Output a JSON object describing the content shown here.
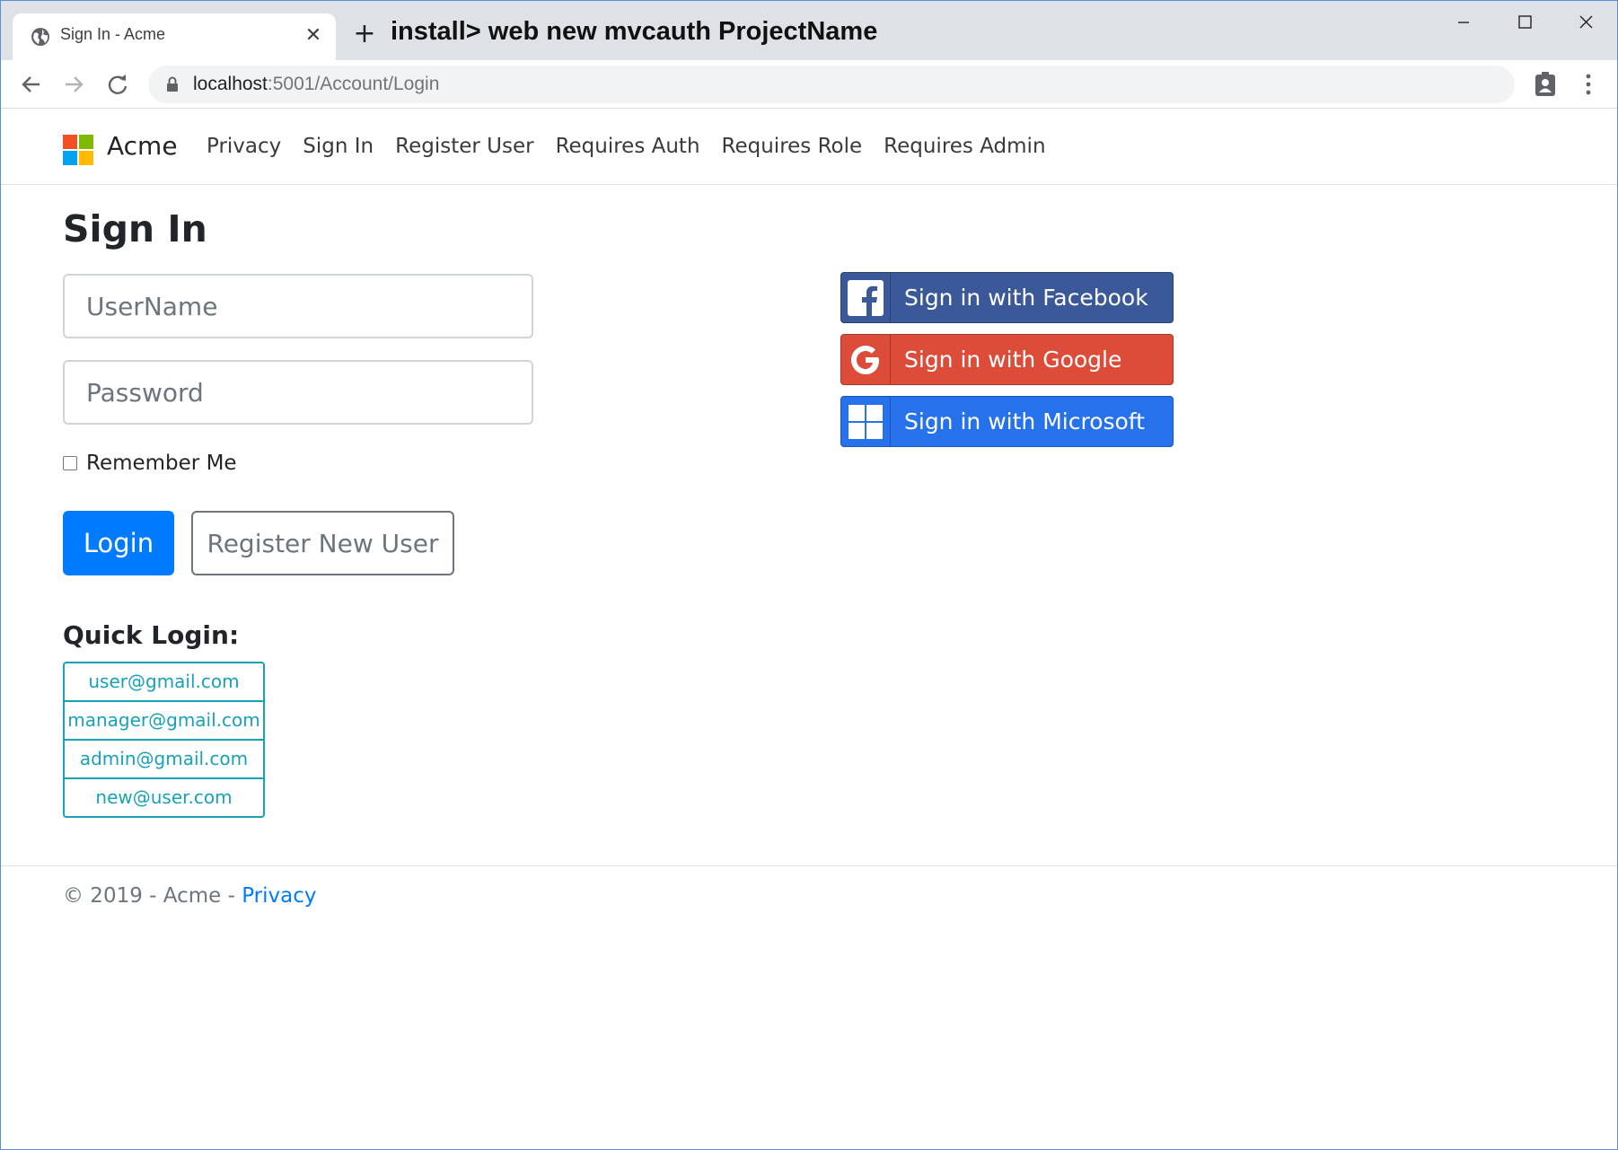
{
  "browser": {
    "tab_title": "Sign In - Acme",
    "tab_close_glyph": "✕",
    "new_tab_glyph": "+",
    "overlay_caption": "install> web new mvcauth ProjectName",
    "url_host": "localhost",
    "url_path": ":5001/Account/Login"
  },
  "site": {
    "brand": "Acme",
    "nav": [
      "Privacy",
      "Sign In",
      "Register User",
      "Requires Auth",
      "Requires Role",
      "Requires Admin"
    ]
  },
  "signin": {
    "heading": "Sign In",
    "username_placeholder": "UserName",
    "password_placeholder": "Password",
    "remember_label": "Remember Me",
    "remember_checked": false,
    "login_label": "Login",
    "register_label": "Register New User",
    "quick_heading": "Quick Login:",
    "quick_logins": [
      "user@gmail.com",
      "manager@gmail.com",
      "admin@gmail.com",
      "new@user.com"
    ]
  },
  "social": {
    "facebook_label": "Sign in with Facebook",
    "google_label": "Sign in with Google",
    "microsoft_label": "Sign in with Microsoft"
  },
  "footer": {
    "text": "© 2019 - Acme - ",
    "link": "Privacy"
  },
  "colors": {
    "primary": "#007bff",
    "info": "#17a2b8",
    "facebook": "#3b5998",
    "google": "#dd4b39",
    "microsoft": "#2672ec"
  }
}
